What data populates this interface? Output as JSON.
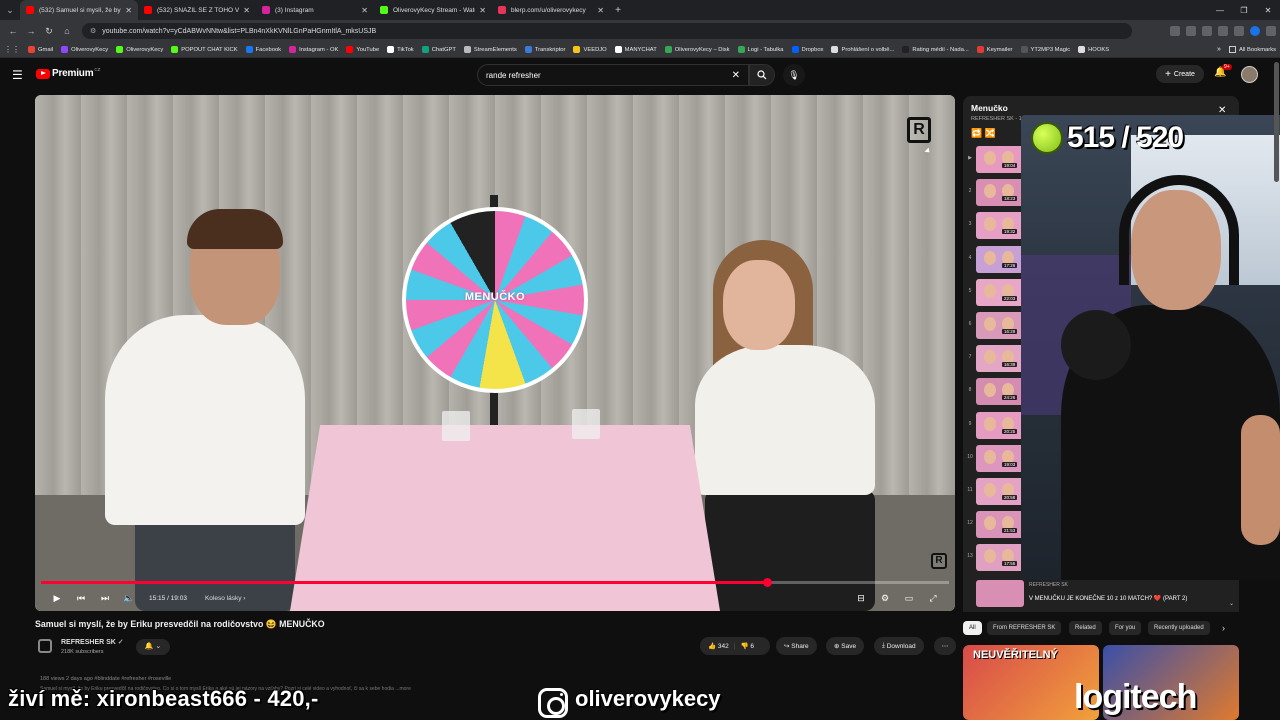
{
  "browser": {
    "tabs": [
      {
        "label": "(532) Samuel si myslí, že by Erik",
        "color": "#ff0000",
        "active": true
      },
      {
        "label": "(532) SNAŽIL SE Z TOHO VYBR",
        "color": "#ff0000",
        "active": false
      },
      {
        "label": "(3) Instagram",
        "color": "#d6249f",
        "active": false
      },
      {
        "label": "OliverovyKecy Stream - Watch",
        "color": "#53fc18",
        "active": false
      },
      {
        "label": "blerp.com/u/oliverovykecy",
        "color": "#e8335a",
        "active": false
      }
    ],
    "url": "youtube.com/watch?v=yCdABWvNNtw&list=PLBn4nXkKVNlLGnPaHGnmItlA_mksUSJB",
    "bookmarks": [
      {
        "label": "Gmail",
        "color": "#ea4335"
      },
      {
        "label": "OliverovyKecy",
        "color": "#9146ff"
      },
      {
        "label": "OliverovyKecy",
        "color": "#53fc18"
      },
      {
        "label": "POPOUT CHAT KICK",
        "color": "#53fc18"
      },
      {
        "label": "Facebook",
        "color": "#1877f2"
      },
      {
        "label": "Instagram - OK",
        "color": "#d6249f"
      },
      {
        "label": "YouTube",
        "color": "#ff0000"
      },
      {
        "label": "TikTok",
        "color": "#ffffff"
      },
      {
        "label": "ChatGPT",
        "color": "#10a37f"
      },
      {
        "label": "StreamElements",
        "color": "#bbbbbb"
      },
      {
        "label": "Transkriptor",
        "color": "#3a7bd5"
      },
      {
        "label": "VEEDJO",
        "color": "#f5c518"
      },
      {
        "label": "MANYCHAT",
        "color": "#ffffff"
      },
      {
        "label": "OliverovyKecy – Disk",
        "color": "#34a853"
      },
      {
        "label": "Logi - Tabulka",
        "color": "#34a853"
      },
      {
        "label": "Dropbox",
        "color": "#0061ff"
      },
      {
        "label": "Prohlášení o volbě...",
        "color": "#dddddd"
      },
      {
        "label": "Rating médií - Nada...",
        "color": "#222222"
      },
      {
        "label": "Keymailer",
        "color": "#e53935"
      },
      {
        "label": "YT2MP3 Magic",
        "color": "#555555"
      },
      {
        "label": "HOOKS",
        "color": "#dddddd"
      }
    ],
    "all_bookmarks": "All Bookmarks"
  },
  "youtube": {
    "brand": "Premium",
    "country": "CZ",
    "search_query": "rande refresher",
    "create_label": "Create",
    "notif_count": "9+"
  },
  "video": {
    "time": "15:15 / 19:03",
    "chapter": "Koleso lásky",
    "progress": 0.8,
    "wheel_text": "MENUČKO",
    "title": "Samuel si myslí, že by Eriku presvedčil na rodičovstvo 😆 MENUČKO",
    "channel": "REFRESHER SK",
    "subs": "218K subscribers",
    "likes": "342",
    "dislikes": "6",
    "share": "Share",
    "save": "Save",
    "download": "Download",
    "views": "188 views  2 days ago  #blinddate #refresher #roseville",
    "desc": "Samuel si myslí, že by Eriku presvedčil na rodičovstvo. Čo si o tom myslí Erika a aké sú jej názory na vzťahy? Pozri si celé video a vyhodnoť, či sa k sebe hodia ...more"
  },
  "playlist": {
    "title": "Menučko",
    "subtitle": "REFRESHER SK - 1",
    "items": [
      {
        "idx": "▶",
        "dur": "19:04"
      },
      {
        "idx": "2",
        "dur": "18:23"
      },
      {
        "idx": "3",
        "dur": "19:32"
      },
      {
        "idx": "4",
        "dur": "17:26"
      },
      {
        "idx": "5",
        "dur": "22:03"
      },
      {
        "idx": "6",
        "dur": "16:29"
      },
      {
        "idx": "7",
        "dur": "16:39"
      },
      {
        "idx": "8",
        "dur": "24:26"
      },
      {
        "idx": "9",
        "dur": "20:25"
      },
      {
        "idx": "10",
        "dur": "19:03"
      },
      {
        "idx": "11",
        "dur": "20:58"
      },
      {
        "idx": "12",
        "dur": "21:53"
      },
      {
        "idx": "13",
        "dur": "17:56"
      }
    ],
    "now_channel": "REFRESHER SK",
    "now_title": "V MENUČKU JE KONEČNE 10 z 10 MATCH? ❤️ (PART 2)"
  },
  "chips": [
    "All",
    "From REFRESHER SK",
    "Related",
    "For you",
    "Recently uploaded"
  ],
  "related": [
    "NEUVĚŘITELNÝ",
    ""
  ],
  "webcam": {
    "counter": "515 / 520"
  },
  "overlay": {
    "left": "živí mě: xironbeast666 - 420,-",
    "instagram": "oliverovykecy",
    "sponsor": "logitech"
  }
}
